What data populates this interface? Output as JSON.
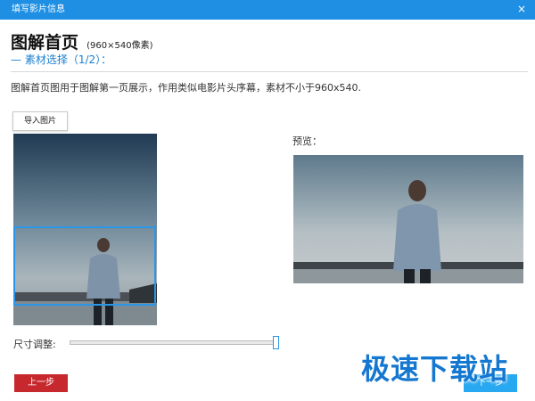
{
  "window": {
    "title": "填写影片信息",
    "close_symbol": "×"
  },
  "header": {
    "title": "图解首页",
    "size_hint": "(960×540像素)",
    "step": "— 素材选择（1/2）："
  },
  "description": "图解首页图用于图解第一页展示，作用类似电影片头序幕，素材不小于960x540.",
  "toolbar": {
    "import_label": "导入图片"
  },
  "preview": {
    "label": "预览："
  },
  "size_adjust": {
    "label": "尺寸调整:",
    "value": 1.0
  },
  "nav": {
    "prev_label": "上一步",
    "next_label": "下一步"
  },
  "watermark": "极速下载站",
  "colors": {
    "titlebar": "#1e8fe3",
    "prev_button": "#c7282e",
    "next_button": "#28a8f0",
    "crop_border": "#2a96e8"
  }
}
